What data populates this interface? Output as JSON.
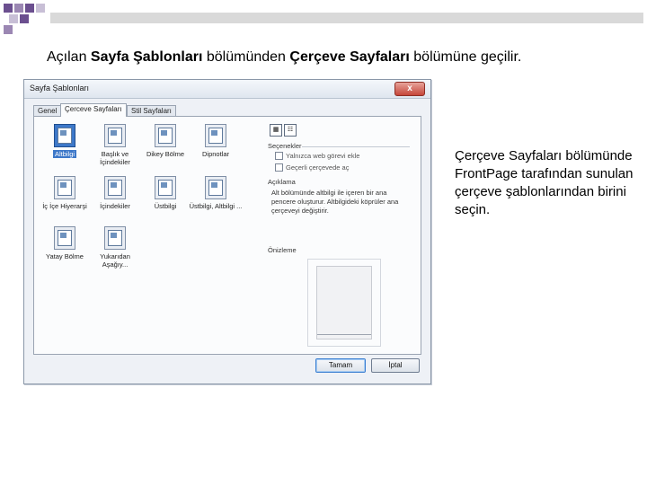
{
  "slide": {
    "heading_prefix": "Açılan ",
    "heading_bold1": "Sayfa Şablonları",
    "heading_mid": " bölümünden ",
    "heading_bold2": "Çerçeve Sayfaları",
    "heading_suffix": " bölümüne geçilir.",
    "caption": "Çerçeve Sayfaları bölümünde FrontPage tarafından sunulan çerçeve şablonlarından birini seçin.",
    "accent_colors": [
      "#6b4f8f",
      "#9b87b3",
      "#c8bfd6"
    ]
  },
  "dialog": {
    "title": "Sayfa Şablonları",
    "close_label": "x",
    "tabs": [
      {
        "label": "Genel",
        "active": false
      },
      {
        "label": "Çerceve Sayfaları",
        "active": true
      },
      {
        "label": "Stil Sayfaları",
        "active": false
      }
    ],
    "templates": [
      {
        "label": "Altbilgi",
        "selected": true
      },
      {
        "label": "Başlık ve İçindekiler",
        "selected": false
      },
      {
        "label": "Dikey Bölme",
        "selected": false
      },
      {
        "label": "Dipnotlar",
        "selected": false
      },
      {
        "label": "İç İçe Hiyerarşi",
        "selected": false
      },
      {
        "label": "İçindekiler",
        "selected": false
      },
      {
        "label": "Üstbilgi",
        "selected": false
      },
      {
        "label": "Üstbilgi, Altbilgi ...",
        "selected": false
      },
      {
        "label": "Yatay Bölme",
        "selected": false
      },
      {
        "label": "Yukarıdan Aşağıy...",
        "selected": false
      }
    ],
    "options_label": "Seçenekler",
    "option1": "Yalnızca web görevi ekle",
    "option2": "Geçerli çerçevede aç",
    "description_label": "Açıklama",
    "description": "Alt bölümünde altbilgi ile içeren bir ana pencere oluşturur. Altbilgideki köprüler ana çerçeveyi değiştirir.",
    "preview_label": "Önizleme",
    "ok_label": "Tamam",
    "cancel_label": "İptal"
  }
}
